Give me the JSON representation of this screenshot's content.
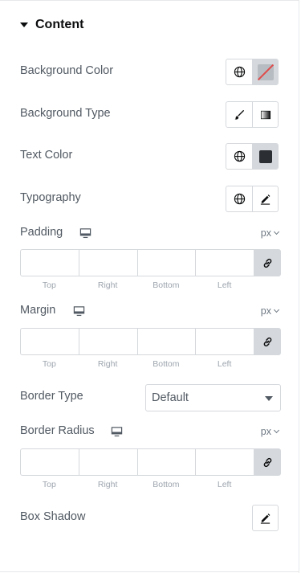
{
  "section": {
    "title": "Content"
  },
  "controls": {
    "background_color": {
      "label": "Background Color"
    },
    "background_type": {
      "label": "Background Type"
    },
    "text_color": {
      "label": "Text Color"
    },
    "typography": {
      "label": "Typography"
    },
    "padding": {
      "label": "Padding",
      "unit": "px",
      "sides": [
        "Top",
        "Right",
        "Bottom",
        "Left"
      ]
    },
    "margin": {
      "label": "Margin",
      "unit": "px",
      "sides": [
        "Top",
        "Right",
        "Bottom",
        "Left"
      ]
    },
    "border_type": {
      "label": "Border Type",
      "value": "Default"
    },
    "border_radius": {
      "label": "Border Radius",
      "unit": "px",
      "sides": [
        "Top",
        "Right",
        "Bottom",
        "Left"
      ]
    },
    "box_shadow": {
      "label": "Box Shadow"
    }
  },
  "colors": {
    "text_color_swatch": "#2b2f33",
    "background_swatch": "#b7bcc2"
  }
}
